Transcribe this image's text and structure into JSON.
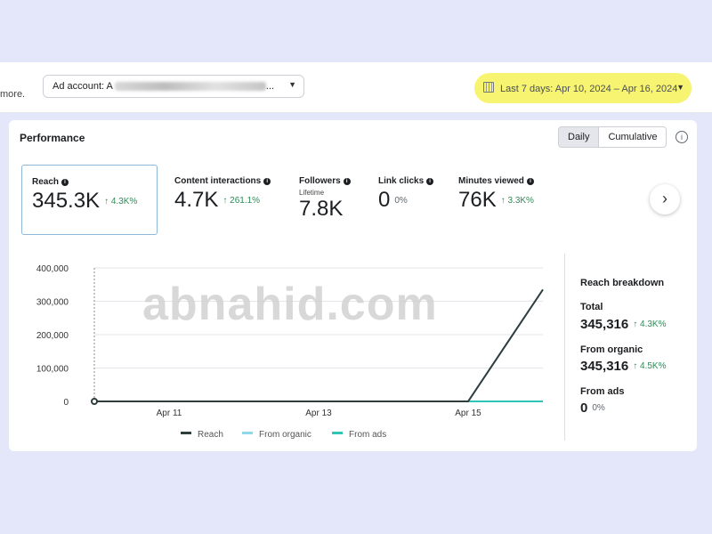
{
  "topbar": {
    "more_text": "more.",
    "ad_account_label": "Ad account: A",
    "ad_account_ellipsis": "...",
    "date_range": "Last 7 days: Apr 10, 2024 – Apr 16, 2024"
  },
  "performance": {
    "title": "Performance",
    "toggle": [
      "Daily",
      "Cumulative"
    ],
    "active_toggle": "Daily",
    "info_icon": "i"
  },
  "metrics": [
    {
      "label": "Reach",
      "sub": "",
      "value": "345.3K",
      "change": "↑ 4.3K%"
    },
    {
      "label": "Content interactions",
      "sub": "",
      "value": "4.7K",
      "change": "↑ 261.1%"
    },
    {
      "label": "Followers",
      "sub": "Lifetime",
      "value": "7.8K",
      "change": ""
    },
    {
      "label": "Link clicks",
      "sub": "",
      "value": "0",
      "change": "0%"
    },
    {
      "label": "Minutes viewed",
      "sub": "",
      "value": "76K",
      "change": "↑ 3.3K%"
    }
  ],
  "next_icon": "›",
  "chart_data": {
    "type": "line",
    "title": "",
    "xlabel": "",
    "ylabel": "",
    "x": [
      "Apr 10",
      "Apr 11",
      "Apr 12",
      "Apr 13",
      "Apr 14",
      "Apr 15",
      "Apr 16"
    ],
    "x_tick_labels": [
      "Apr 11",
      "Apr 13",
      "Apr 15"
    ],
    "y_tick_labels": [
      "400,000",
      "300,000",
      "200,000",
      "100,000",
      "0"
    ],
    "ylim": [
      0,
      400000
    ],
    "grid": true,
    "legend_position": "bottom",
    "series": [
      {
        "name": "Reach",
        "color": "#2f3d3d",
        "values": [
          0,
          0,
          0,
          0,
          0,
          0,
          335000
        ]
      },
      {
        "name": "From organic",
        "color": "#8fd8e8",
        "values": [
          0,
          0,
          0,
          0,
          0,
          0,
          335000
        ]
      },
      {
        "name": "From ads",
        "color": "#2ec4b6",
        "values": [
          0,
          0,
          0,
          0,
          0,
          0,
          0
        ]
      }
    ]
  },
  "breakdown": {
    "title": "Reach breakdown",
    "total_label": "Total",
    "total_value": "345,316",
    "total_change": "↑ 4.3K%",
    "organic_label": "From organic",
    "organic_value": "345,316",
    "organic_change": "↑ 4.5K%",
    "ads_label": "From ads",
    "ads_value": "0",
    "ads_change": "0%"
  },
  "watermark": "abnahid.com",
  "colors": {
    "highlight": "#f6f471",
    "positive": "#2e8b57",
    "selected_border": "#8fb8d8"
  }
}
